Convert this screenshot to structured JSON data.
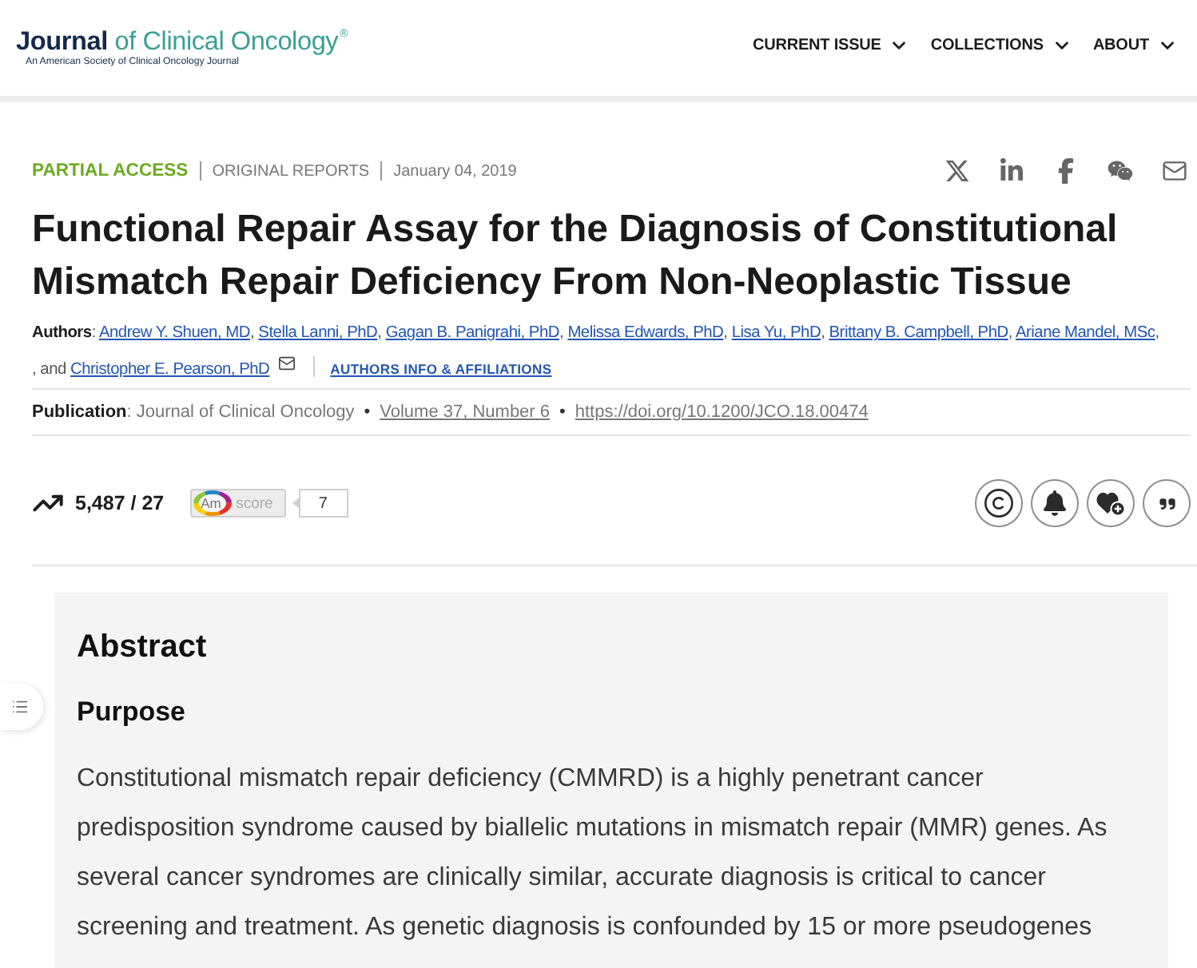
{
  "header": {
    "logo": {
      "word": "Journal",
      "rest": "of Clinical Oncology",
      "mark": "®",
      "tagline": "An American Society of Clinical Oncology Journal"
    },
    "nav": [
      {
        "label": "CURRENT ISSUE"
      },
      {
        "label": "COLLECTIONS"
      },
      {
        "label": "ABOUT"
      }
    ]
  },
  "article": {
    "access": "PARTIAL ACCESS",
    "type": "ORIGINAL REPORTS",
    "date": "January 04, 2019",
    "title": "Functional Repair Assay for the Diagnosis of Constitutional Mismatch Repair Deficiency From Non-Neoplastic Tissue",
    "authors": {
      "label": "Authors",
      "label_separator": ":",
      "names": [
        {
          "name": "Andrew Y. Shuen, MD",
          "sep": ","
        },
        {
          "name": "Stella Lanni, PhD",
          "sep": ","
        },
        {
          "name": "Gagan B. Panigrahi, PhD",
          "sep": ","
        },
        {
          "name": "Melissa Edwards, PhD",
          "sep": ","
        },
        {
          "name": "Lisa Yu, PhD",
          "sep": ","
        },
        {
          "name": "Brittany B. Campbell, PhD",
          "sep": ","
        },
        {
          "name": "Ariane Mandel, MSc",
          "sep": ","
        }
      ],
      "last": {
        "lead": ", and",
        "name": "Christopher E. Pearson, PhD"
      },
      "info_link": "AUTHORS INFO & AFFILIATIONS"
    },
    "publication": {
      "label": "Publication",
      "label_separator": ":",
      "parts": [
        {
          "kind": "text",
          "text": "Journal of Clinical Oncology"
        },
        {
          "kind": "bullet",
          "text": "•"
        },
        {
          "kind": "link",
          "text": "Volume 37, Number 6"
        },
        {
          "kind": "bullet",
          "text": "•"
        },
        {
          "kind": "link",
          "text": "https://doi.org/10.1200/JCO.18.00474"
        }
      ]
    },
    "metrics": {
      "counts": "5,487 / 27",
      "badge": {
        "mark": "Am",
        "label": "score"
      },
      "score": "7"
    }
  },
  "abstract": {
    "heading": "Abstract",
    "sections": [
      {
        "heading": "Purpose",
        "text": "Constitutional mismatch repair deficiency (CMMRD) is a highly penetrant cancer predisposition syndrome caused by biallelic mutations in mismatch repair (MMR) genes. As several cancer syndromes are clinically similar, accurate diagnosis is critical to cancer screening and treatment. As genetic diagnosis is confounded by 15 or more pseudogenes"
      }
    ]
  }
}
